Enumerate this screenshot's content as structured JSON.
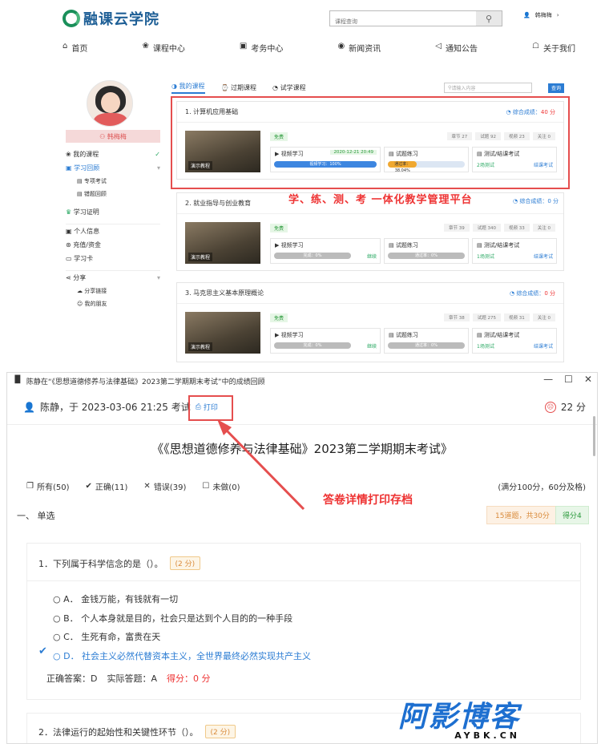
{
  "top": {
    "logo_text": "融课云学院",
    "search_placeholder": "课程查询",
    "user_name": "韩梅梅",
    "nav": [
      {
        "icon": "home-icon",
        "glyph": "⌂",
        "label": "首页"
      },
      {
        "icon": "book-icon",
        "glyph": "❀",
        "label": "课程中心"
      },
      {
        "icon": "calendar-icon",
        "glyph": "▣",
        "label": "考务中心"
      },
      {
        "icon": "news-icon",
        "glyph": "◉",
        "label": "新闻资讯"
      },
      {
        "icon": "bell-icon",
        "glyph": "◁",
        "label": "通知公告"
      },
      {
        "icon": "people-icon",
        "glyph": "☖",
        "label": "关于我们"
      }
    ],
    "sidebar": {
      "user_label": "韩梅梅",
      "items": [
        {
          "label": "我的课程",
          "mark": "✓"
        },
        {
          "label": "学习回顾",
          "mark": "▾"
        },
        {
          "label": "专项考试",
          "sub": true
        },
        {
          "label": "错题回顾",
          "sub": true
        },
        {
          "label": "学习证明"
        },
        {
          "label": "个人信息"
        },
        {
          "label": "充值/资金"
        },
        {
          "label": "学习卡"
        },
        {
          "label": "分享",
          "mark": "▾"
        },
        {
          "label": "分享链接",
          "sub": true
        },
        {
          "label": "我的朋友",
          "sub": true
        }
      ]
    },
    "tabs": [
      "我的课程",
      "过期课程",
      "试学课程"
    ],
    "tab_search_placeholder": "请输入内容",
    "tab_search_btn": "查询",
    "courses": [
      {
        "title": "1. 计算机应用基础",
        "score_label": "综合成绩：",
        "score": "40 分",
        "tag": "免费",
        "stats": [
          "章节 27",
          "试题 92",
          "视频 23",
          "关注 0"
        ],
        "video": "视频学习",
        "date": "2020-12-21 20:49",
        "video_progress": "视频学习：100%",
        "practice": "试题练习",
        "practice_progress": "通过率：38.04%",
        "test": "测试/结课考试",
        "test_count": "2场测试",
        "action": "结课考试"
      },
      {
        "title": "2. 就业指导与创业教育",
        "score_label": "综合成绩：",
        "score": "0 分",
        "tag": "免费",
        "stats": [
          "章节 39",
          "试题 340",
          "视频 33",
          "关注 0"
        ],
        "video": "视频学习",
        "video_progress": "完成：0%",
        "practice": "试题练习",
        "practice_progress": "通过率：0%",
        "test": "测试/结课考试",
        "test_count": "1场测试",
        "action": "结课考试",
        "continue": "继续"
      },
      {
        "title": "3. 马克思主义基本原理概论",
        "score_label": "综合成绩：",
        "score": "0 分",
        "tag": "免费",
        "stats": [
          "章节 38",
          "试题 275",
          "视频 31",
          "关注 0"
        ],
        "video": "视频学习",
        "video_progress": "完成：0%",
        "practice": "试题练习",
        "practice_progress": "通过率：0%",
        "test": "测试/结课考试",
        "test_count": "1场测试",
        "action": "结课考试",
        "continue": "继续"
      }
    ],
    "thumb_label": "演示教程",
    "slogan": "学、练、测、考 一体化教学管理平台"
  },
  "bottom": {
    "window_title": "陈静在“《思想道德修养与法律基础》2023第二学期期末考试”中的成绩回顾",
    "exam_line": "陈静，于 2023-03-06 21:25 考试",
    "print_label": "打印",
    "total_score": "22 分",
    "exam_title": "《《思想道德修养与法律基础》2023第二学期期末考试》",
    "filters": [
      {
        "icon": "copy-icon",
        "glyph": "❐",
        "label": "所有(50)"
      },
      {
        "icon": "check-icon",
        "glyph": "✔",
        "label": "正确(11)"
      },
      {
        "icon": "cross-icon",
        "glyph": "✕",
        "label": "错误(39)"
      },
      {
        "icon": "box-icon",
        "glyph": "☐",
        "label": "未做(0)"
      }
    ],
    "full_score": "(满分100分，60分及格)",
    "annotation": "答卷详情打印存档",
    "section": "一、 单选",
    "section_count": "15道题，共30分",
    "section_score": "得分4",
    "q1": {
      "title": "1．下列属于科学信念的是（）。",
      "points": "(2 分)",
      "options": [
        "○ A． 金钱万能，有钱就有一切",
        "○ B． 个人本身就是目的，社会只是达到个人目的的一种手段",
        "○ C． 生死有命，富贵在天",
        "○ D． 社会主义必然代替资本主义，全世界最终必然实现共产主义"
      ],
      "correct": "正确答案：D",
      "actual": "实际答题：A",
      "score": "得分：0 分"
    },
    "q2": {
      "title": "2．法律运行的起始性和关键性环节（）。",
      "points": "(2 分)"
    },
    "watermark": {
      "big": "阿影博客",
      "small": "AYBK.CN"
    }
  },
  "colors": {
    "accent": "#2b7cd3",
    "annotation": "#e33333",
    "green": "#28a862"
  }
}
